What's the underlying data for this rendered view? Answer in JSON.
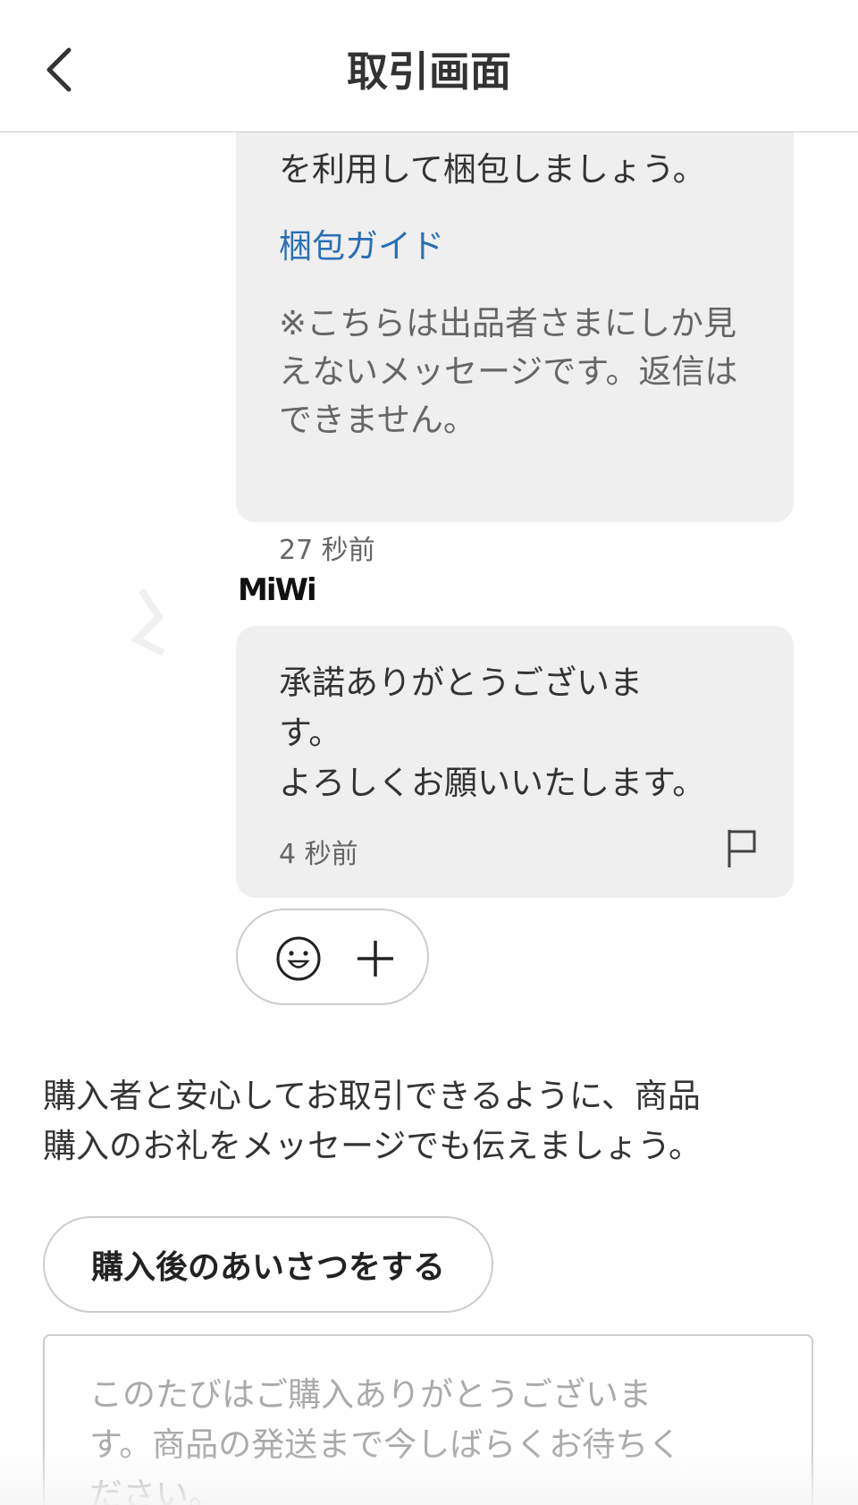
{
  "header": {
    "title": "取引画面",
    "back_icon": "chevron-left-icon"
  },
  "system_message": {
    "clipped_top_line": "・・ー・・ーー・・・ー・・・",
    "lines": [
      "を利用して梱包しましょう。"
    ],
    "link_label": "梱包ガイド",
    "note": "※こちらは出品者さまにしか見えないメッセージです。返信はできません。",
    "time": "27 秒前"
  },
  "buyer_message": {
    "sender": "MiWi",
    "lines": [
      "承諾ありがとうございま",
      "す。",
      "よろしくお願いいたします。"
    ],
    "time": "4 秒前",
    "flag_icon": "flag-icon"
  },
  "reactions": {
    "emoji_icon": "smiley-icon",
    "add_icon": "plus-icon"
  },
  "tip": {
    "lines": [
      "購入者と安心してお取引できるように、商品",
      "購入のお礼をメッセージでも伝えましょう。"
    ]
  },
  "greeting_button": {
    "label": "購入後のあいさつをする"
  },
  "message_input": {
    "placeholder_lines": [
      "このたびはご購入ありがとうございま",
      "す。商品の発送まで今しばらくお待ちく",
      "ださい。"
    ]
  },
  "colors": {
    "link": "#2a6eb5",
    "bubble": "#efefef",
    "border": "#cccccc",
    "placeholder": "#aaaaaa"
  }
}
